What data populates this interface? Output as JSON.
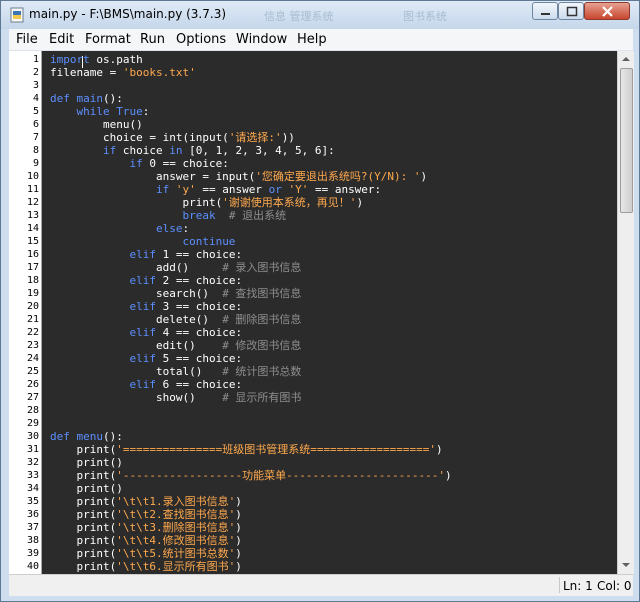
{
  "window": {
    "title": "main.py - F:\\BMS\\main.py (3.7.3)",
    "ghost_text": [
      "信息 管理系统",
      "图书系统"
    ]
  },
  "menu": [
    "File",
    "Edit",
    "Format",
    "Run",
    "Options",
    "Window",
    "Help"
  ],
  "status": {
    "line": "Ln: 1",
    "col": "Col: 0"
  },
  "colors": {
    "keyword": "#5d8fff",
    "string": "#ffa94d",
    "comment": "#8e8e8e",
    "background": "#2b2b2b"
  },
  "editor": {
    "lines": [
      [
        [
          "kw",
          "import"
        ],
        [
          "p",
          " os.path"
        ]
      ],
      [
        [
          "p",
          "filename = "
        ],
        [
          "str",
          "'books.txt'"
        ]
      ],
      [],
      [
        [
          "kw",
          "def"
        ],
        [
          "p",
          " "
        ],
        [
          "kw",
          "main"
        ],
        [
          "p",
          "():"
        ]
      ],
      [
        [
          "p",
          "    "
        ],
        [
          "kw",
          "while"
        ],
        [
          "p",
          " "
        ],
        [
          "kw",
          "True"
        ],
        [
          "p",
          ":"
        ]
      ],
      [
        [
          "p",
          "        menu()"
        ]
      ],
      [
        [
          "p",
          "        choice = int(input("
        ],
        [
          "str",
          "'请选择:'"
        ],
        [
          "p",
          "))"
        ]
      ],
      [
        [
          "p",
          "        "
        ],
        [
          "kw",
          "if"
        ],
        [
          "p",
          " choice "
        ],
        [
          "kw",
          "in"
        ],
        [
          "p",
          " [0, 1, 2, 3, 4, 5, 6]:"
        ]
      ],
      [
        [
          "p",
          "            "
        ],
        [
          "kw",
          "if"
        ],
        [
          "p",
          " 0 == choice:"
        ]
      ],
      [
        [
          "p",
          "                answer = input("
        ],
        [
          "str",
          "'您确定要退出系统吗?(Y/N): '"
        ],
        [
          "p",
          ")"
        ]
      ],
      [
        [
          "p",
          "                "
        ],
        [
          "kw",
          "if"
        ],
        [
          "p",
          " "
        ],
        [
          "str",
          "'y'"
        ],
        [
          "p",
          " == answer "
        ],
        [
          "kw",
          "or"
        ],
        [
          "p",
          " "
        ],
        [
          "str",
          "'Y'"
        ],
        [
          "p",
          " == answer:"
        ]
      ],
      [
        [
          "p",
          "                    print("
        ],
        [
          "str",
          "'谢谢使用本系统，再见！'"
        ],
        [
          "p",
          ")"
        ]
      ],
      [
        [
          "p",
          "                    "
        ],
        [
          "kw",
          "break"
        ],
        [
          "p",
          "  "
        ],
        [
          "cm",
          "# 退出系统"
        ]
      ],
      [
        [
          "p",
          "                "
        ],
        [
          "kw",
          "else"
        ],
        [
          "p",
          ":"
        ]
      ],
      [
        [
          "p",
          "                    "
        ],
        [
          "kw",
          "continue"
        ]
      ],
      [
        [
          "p",
          "            "
        ],
        [
          "kw",
          "elif"
        ],
        [
          "p",
          " 1 == choice:"
        ]
      ],
      [
        [
          "p",
          "                add()     "
        ],
        [
          "cm",
          "# 录入图书信息"
        ]
      ],
      [
        [
          "p",
          "            "
        ],
        [
          "kw",
          "elif"
        ],
        [
          "p",
          " 2 == choice:"
        ]
      ],
      [
        [
          "p",
          "                search()  "
        ],
        [
          "cm",
          "# 查找图书信息"
        ]
      ],
      [
        [
          "p",
          "            "
        ],
        [
          "kw",
          "elif"
        ],
        [
          "p",
          " 3 == choice:"
        ]
      ],
      [
        [
          "p",
          "                delete()  "
        ],
        [
          "cm",
          "# 删除图书信息"
        ]
      ],
      [
        [
          "p",
          "            "
        ],
        [
          "kw",
          "elif"
        ],
        [
          "p",
          " 4 == choice:"
        ]
      ],
      [
        [
          "p",
          "                edit()    "
        ],
        [
          "cm",
          "# 修改图书信息"
        ]
      ],
      [
        [
          "p",
          "            "
        ],
        [
          "kw",
          "elif"
        ],
        [
          "p",
          " 5 == choice:"
        ]
      ],
      [
        [
          "p",
          "                total()   "
        ],
        [
          "cm",
          "# 统计图书总数"
        ]
      ],
      [
        [
          "p",
          "            "
        ],
        [
          "kw",
          "elif"
        ],
        [
          "p",
          " 6 == choice:"
        ]
      ],
      [
        [
          "p",
          "                show()    "
        ],
        [
          "cm",
          "# 显示所有图书"
        ]
      ],
      [],
      [],
      [
        [
          "kw",
          "def"
        ],
        [
          "p",
          " "
        ],
        [
          "kw",
          "menu"
        ],
        [
          "p",
          "():"
        ]
      ],
      [
        [
          "p",
          "    print("
        ],
        [
          "str",
          "'===============班级图书管理系统=================='"
        ],
        [
          "p",
          ")"
        ]
      ],
      [
        [
          "p",
          "    print()"
        ]
      ],
      [
        [
          "p",
          "    print("
        ],
        [
          "str",
          "'------------------功能菜单-----------------------'"
        ],
        [
          "p",
          ")"
        ]
      ],
      [
        [
          "p",
          "    print()"
        ]
      ],
      [
        [
          "p",
          "    print("
        ],
        [
          "str",
          "'\\t\\t1.录入图书信息'"
        ],
        [
          "p",
          ")"
        ]
      ],
      [
        [
          "p",
          "    print("
        ],
        [
          "str",
          "'\\t\\t2.查找图书信息'"
        ],
        [
          "p",
          ")"
        ]
      ],
      [
        [
          "p",
          "    print("
        ],
        [
          "str",
          "'\\t\\t3.删除图书信息'"
        ],
        [
          "p",
          ")"
        ]
      ],
      [
        [
          "p",
          "    print("
        ],
        [
          "str",
          "'\\t\\t4.修改图书信息'"
        ],
        [
          "p",
          ")"
        ]
      ],
      [
        [
          "p",
          "    print("
        ],
        [
          "str",
          "'\\t\\t5.统计图书总数'"
        ],
        [
          "p",
          ")"
        ]
      ],
      [
        [
          "p",
          "    print("
        ],
        [
          "str",
          "'\\t\\t6.显示所有图书'"
        ],
        [
          "p",
          ")"
        ]
      ]
    ]
  }
}
